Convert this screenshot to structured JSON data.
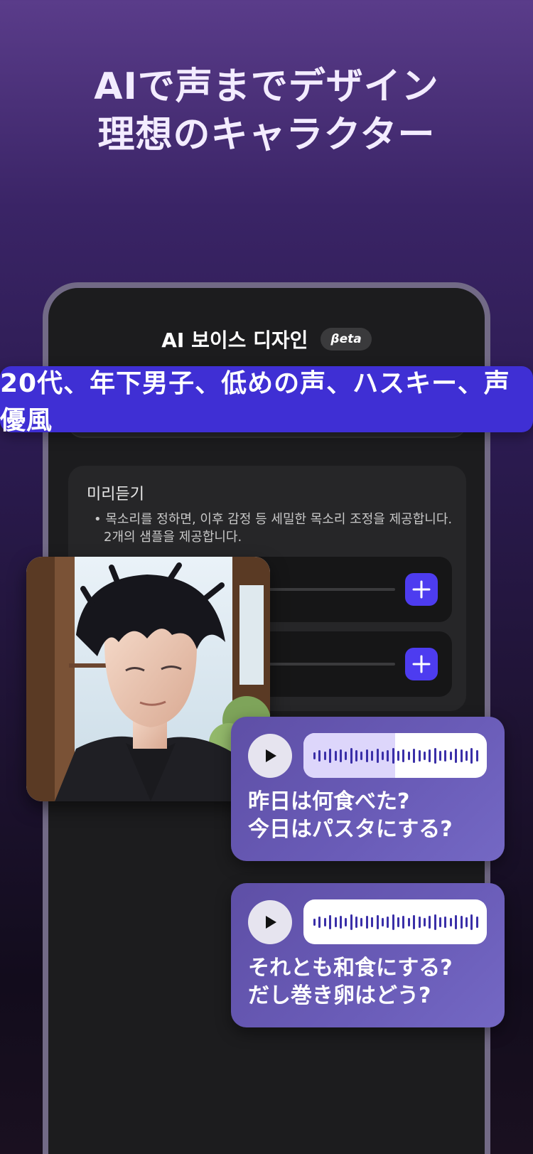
{
  "headline": {
    "line1": "AIで声までデザイン",
    "line2": "理想のキャラクター"
  },
  "phone_screen": {
    "title": "AI 보이스 디자인",
    "beta_badge": "βeta"
  },
  "prompt_banner": {
    "text": "20代、年下男子、低めの声、ハスキー、声優風"
  },
  "preview": {
    "title": "미리듣기",
    "note": "• 목소리를 정하면, 이후 감정 등 세밀한 목소리 조정을 제공합니다. 2개의 샘플을 제공합니다.",
    "samples": [
      {
        "add_icon": "plus-icon"
      },
      {
        "add_icon": "plus-icon"
      }
    ]
  },
  "portrait": {
    "icon": "character-portrait"
  },
  "voice_samples": [
    {
      "line1": "昨日は何食べた?",
      "line2": "今日はパスタにする?",
      "playback_progress": 0.5
    },
    {
      "line1": "それとも和食にする?",
      "line2": "だし巻き卵はどう?",
      "playback_progress": 0.0
    }
  ],
  "colors": {
    "accent": "#4d3cf0",
    "banner": "#3f2fd4",
    "bubble": "#6a5cb8",
    "waveform": "#3a2fa8"
  }
}
